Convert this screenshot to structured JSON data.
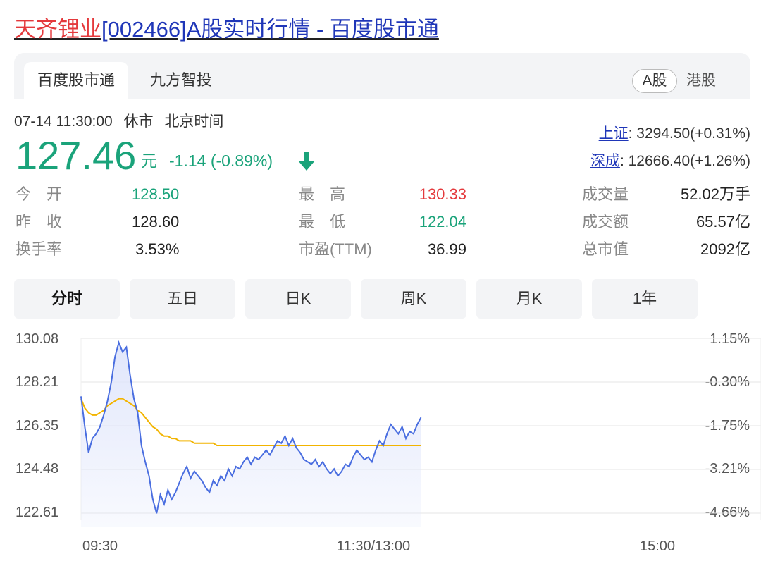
{
  "header": {
    "stock_name": "天齐锂业",
    "title_rest": "[002466]A股实时行情 - 百度股市通"
  },
  "tabs": {
    "items": [
      "百度股市通",
      "九方智投"
    ],
    "active": "百度股市通",
    "market_a": "A股",
    "market_hk": "港股"
  },
  "quote": {
    "datetime": "07-14 11:30:00",
    "status": "休市",
    "timezone": "北京时间",
    "price": "127.46",
    "unit": "元",
    "change": "-1.14 (-0.89%)",
    "direction": "down",
    "color_down": "#1aa37a",
    "color_up": "#e4393c"
  },
  "indices": [
    {
      "name": "上证",
      "value": ": 3294.50(+0.31%)"
    },
    {
      "name": "深成",
      "value": ": 12666.40(+1.26%)"
    }
  ],
  "stats": {
    "open_label": "今　开",
    "open": "128.50",
    "prev_label": "昨　收",
    "prev": "128.60",
    "turnover_label": "换手率",
    "turnover": "3.53%",
    "high_label": "最　高",
    "high": "130.33",
    "low_label": "最　低",
    "low": "122.04",
    "pe_label": "市盈(TTM)",
    "pe": "36.99",
    "volume_label": "成交量",
    "volume": "52.02万手",
    "amount_label": "成交额",
    "amount": "65.57亿",
    "mktcap_label": "总市值",
    "mktcap": "2092亿"
  },
  "periods": [
    "分时",
    "五日",
    "日K",
    "周K",
    "月K",
    "1年"
  ],
  "active_period": "分时",
  "chart_data": {
    "type": "line",
    "y_ticks": [
      "130.08",
      "128.21",
      "126.35",
      "124.48",
      "122.61"
    ],
    "y_pct_ticks": [
      "1.15%",
      "-0.30%",
      "-1.75%",
      "-3.21%",
      "-4.66%"
    ],
    "x_ticks": [
      "09:30",
      "11:30/13:00",
      "15:00"
    ],
    "ylim": [
      122.61,
      130.08
    ],
    "x_range_minutes": [
      0,
      240
    ],
    "prev_close": 128.6,
    "grid": true,
    "colors": {
      "price": "#4a6ee0",
      "avg": "#f2b400",
      "fill": "#dfe5fb"
    },
    "series": [
      {
        "values": [
          127.6,
          126.3,
          125.2,
          125.8,
          126.0,
          126.3,
          126.8,
          127.4,
          128.2,
          129.3,
          129.9,
          129.5,
          129.7,
          128.5,
          127.5,
          126.9,
          125.5,
          124.8,
          124.2,
          123.2,
          122.6,
          123.4,
          123.0,
          123.6,
          123.2,
          123.5,
          123.9,
          124.3,
          124.6,
          124.1,
          124.4,
          124.2,
          124.0,
          123.7,
          123.5,
          124.0,
          123.8,
          124.2,
          124.0,
          124.5,
          124.2,
          124.6,
          124.5,
          124.8,
          125.0,
          124.7,
          125.0,
          124.9,
          125.1,
          125.3,
          125.1,
          125.4,
          125.7,
          125.6,
          125.9,
          125.5,
          125.8,
          125.4,
          125.2,
          124.9,
          124.8,
          124.7,
          124.9,
          124.6,
          124.8,
          124.5,
          124.3,
          124.5,
          124.2,
          124.4,
          124.7,
          124.6,
          125.0,
          125.3,
          125.1,
          124.9,
          125.0,
          124.8,
          125.3,
          125.7,
          125.5,
          126.0,
          126.4,
          126.2,
          126.0,
          126.3,
          125.8,
          126.1,
          126.0,
          126.4,
          126.7
        ]
      },
      {
        "values": [
          127.5,
          127.1,
          126.9,
          126.8,
          126.8,
          126.9,
          127.0,
          127.2,
          127.3,
          127.4,
          127.5,
          127.5,
          127.4,
          127.3,
          127.2,
          127.0,
          126.9,
          126.7,
          126.5,
          126.3,
          126.2,
          126.0,
          125.9,
          125.9,
          125.8,
          125.8,
          125.7,
          125.7,
          125.7,
          125.7,
          125.6,
          125.6,
          125.6,
          125.6,
          125.6,
          125.6,
          125.5,
          125.5,
          125.5,
          125.5,
          125.5,
          125.5,
          125.5,
          125.5,
          125.5,
          125.5,
          125.5,
          125.5,
          125.5,
          125.5,
          125.5,
          125.5,
          125.5,
          125.5,
          125.5,
          125.5,
          125.5,
          125.5,
          125.5,
          125.5,
          125.5,
          125.5,
          125.5,
          125.5,
          125.5,
          125.5,
          125.5,
          125.5,
          125.5,
          125.5,
          125.5,
          125.5,
          125.5,
          125.5,
          125.5,
          125.5,
          125.5,
          125.5,
          125.5,
          125.5,
          125.5,
          125.5,
          125.5,
          125.5,
          125.5,
          125.5,
          125.5,
          125.5,
          125.5,
          125.5,
          125.5
        ]
      }
    ]
  }
}
